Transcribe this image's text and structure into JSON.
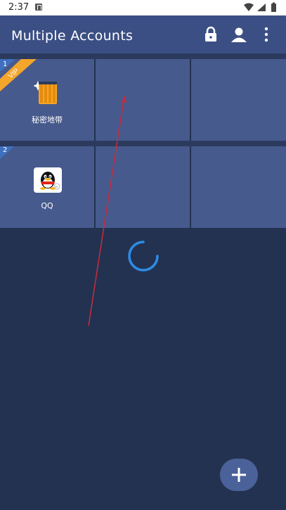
{
  "status_bar": {
    "time": "2:37"
  },
  "app_bar": {
    "title": "Multiple Accounts"
  },
  "rows": [
    {
      "index": "1",
      "vip_label": "VIP",
      "app_label": "秘密地带"
    },
    {
      "index": "2",
      "app_label": "QQ"
    }
  ],
  "colors": {
    "background": "#243251",
    "appbar": "#3b4f84",
    "cell": "#475a8d",
    "vip": "#f4a52b",
    "spinner": "#2d8de6"
  }
}
